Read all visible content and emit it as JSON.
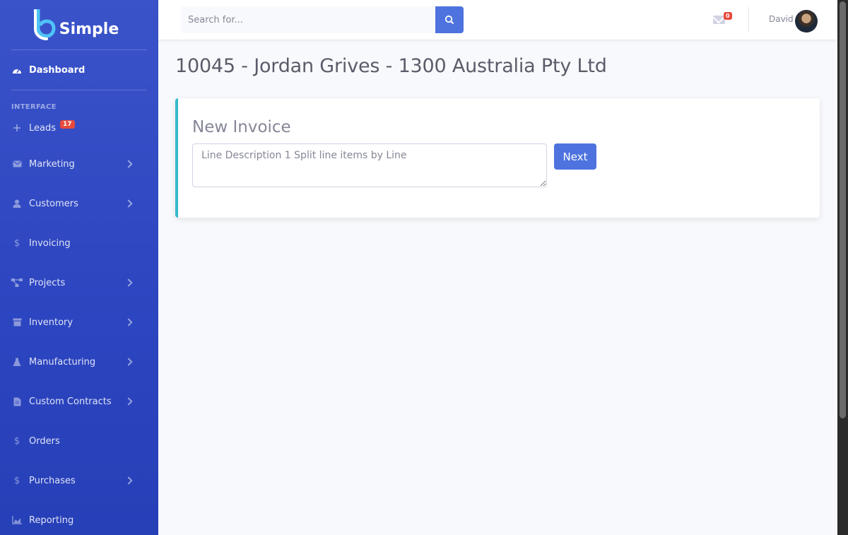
{
  "brand": {
    "name": "Simple"
  },
  "sidebar": {
    "dashboard_label": "Dashboard",
    "section_heading": "INTERFACE",
    "leads": {
      "label": "Leads",
      "badge": "17"
    },
    "items": [
      {
        "label": "Marketing",
        "icon": "envelope-icon",
        "has_submenu": true
      },
      {
        "label": "Customers",
        "icon": "user-icon",
        "has_submenu": true
      },
      {
        "label": "Invoicing",
        "icon": "dollar-icon",
        "has_submenu": false
      },
      {
        "label": "Projects",
        "icon": "project-diagram-icon",
        "has_submenu": true
      },
      {
        "label": "Inventory",
        "icon": "box-icon",
        "has_submenu": true
      },
      {
        "label": "Manufacturing",
        "icon": "flask-icon",
        "has_submenu": true
      },
      {
        "label": "Custom Contracts",
        "icon": "file-contract-icon",
        "has_submenu": true
      },
      {
        "label": "Orders",
        "icon": "dollar-icon",
        "has_submenu": false
      },
      {
        "label": "Purchases",
        "icon": "dollar-icon",
        "has_submenu": true
      },
      {
        "label": "Reporting",
        "icon": "chart-area-icon",
        "has_submenu": false
      }
    ]
  },
  "topbar": {
    "search_placeholder": "Search for...",
    "messages_badge": "0",
    "username": "David"
  },
  "main": {
    "page_title": "10045 - Jordan Grives - 1300 Australia Pty Ltd",
    "card": {
      "title": "New Invoice",
      "textarea_placeholder": "Line Description 1 Split line items by Line",
      "next_label": "Next"
    }
  },
  "colors": {
    "primary": "#4e73df",
    "info_border": "#36b9cc",
    "danger_badge": "#e74a3b",
    "sidebar": "#2c45c0"
  }
}
